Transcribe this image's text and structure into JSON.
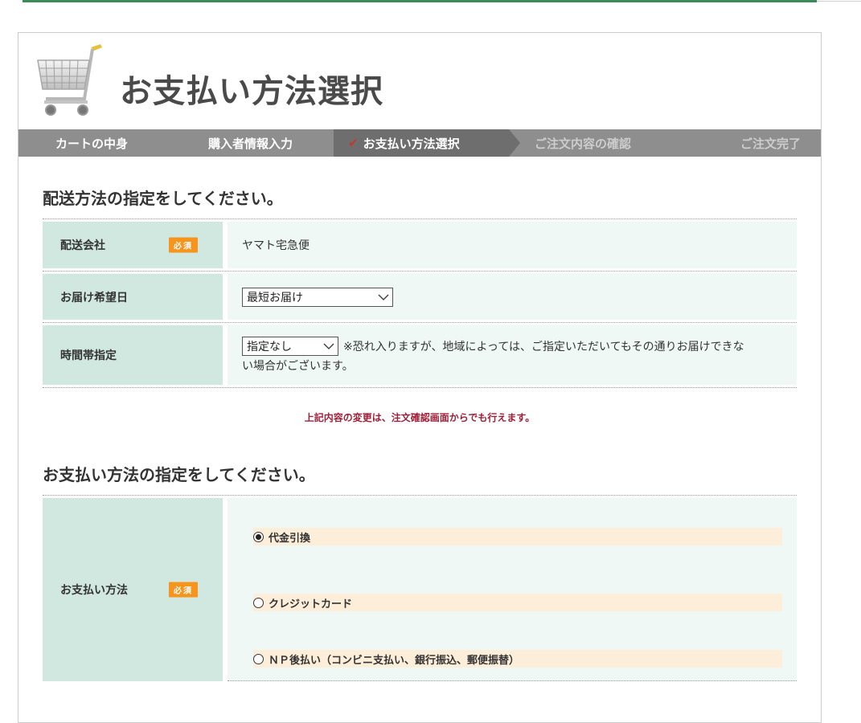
{
  "page": {
    "title": "お支払い方法選択"
  },
  "steps": [
    {
      "label": "カートの中身",
      "state": "done"
    },
    {
      "label": "購入者情報入力",
      "state": "done"
    },
    {
      "label": "お支払い方法選択",
      "state": "active"
    },
    {
      "label": "ご注文内容の確認",
      "state": "future"
    },
    {
      "label": "ご注文完了",
      "state": "future"
    }
  ],
  "delivery": {
    "section_title": "配送方法の指定をしてください。",
    "required_badge": "必須",
    "carrier": {
      "label": "配送会社",
      "value": "ヤマト宅急便"
    },
    "date": {
      "label": "お届け希望日",
      "selected": "最短お届け"
    },
    "time": {
      "label": "時間帯指定",
      "selected": "指定なし",
      "note_line1": "※恐れ入りますが、地域によっては、ご指定いただいてもその通りお届けできな",
      "note_line2": "い場合がございます。"
    }
  },
  "notice": "上記内容の変更は、注文確認画面からでも行えます。",
  "payment": {
    "section_title": "お支払い方法の指定をしてください。",
    "label": "お支払い方法",
    "required_badge": "必須",
    "options": [
      {
        "label": "代金引換",
        "checked": true
      },
      {
        "label": "クレジットカード",
        "checked": false
      },
      {
        "label": "ＮＰ後払い（コンビニ支払い、銀行振込、郵便振替）",
        "checked": false
      }
    ]
  },
  "colors": {
    "label_bg": "#d1e8e0",
    "value_bg": "#eff8f4",
    "option_bg": "#fdeeda",
    "badge": "#f7941d",
    "notice": "#a0203a",
    "step_bar": "#8e8e8e"
  }
}
